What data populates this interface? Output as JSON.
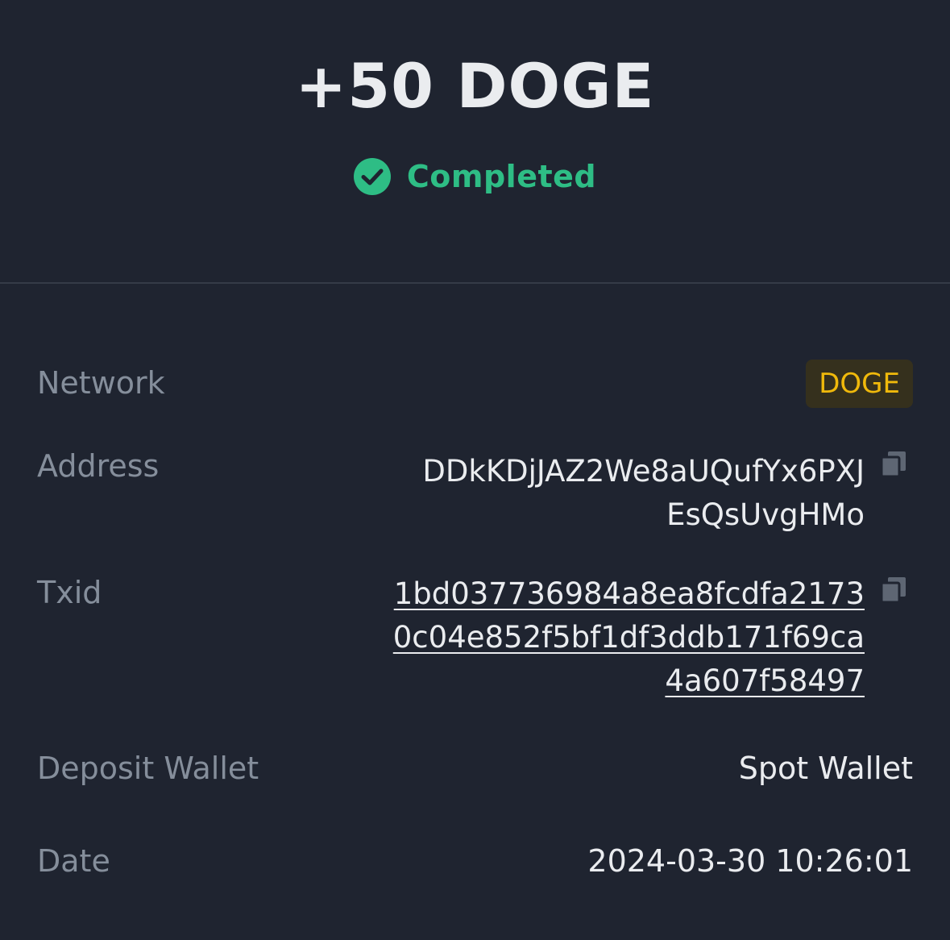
{
  "header": {
    "amount": "+50 DOGE",
    "status": "Completed"
  },
  "details": {
    "network_label": "Network",
    "network_value": "DOGE",
    "address_label": "Address",
    "address_line1": "DDkKDjJAZ2We8aUQufYx6PXJ",
    "address_line2": "EsQsUvgHMo",
    "txid_label": "Txid",
    "txid_line1": "1bd037736984a8ea8fcdfa2173",
    "txid_line2": "0c04e852f5bf1df3ddb171f69ca",
    "txid_line3": "4a607f58497",
    "wallet_label": "Deposit Wallet",
    "wallet_value": "Spot Wallet",
    "date_label": "Date",
    "date_value": "2024-03-30 10:26:01"
  },
  "icons": {
    "status": "check-circle-icon",
    "copy": "copy-icon"
  },
  "colors": {
    "background": "#1f2430",
    "success": "#2ebd85",
    "network_accent": "#f0b90b",
    "label": "#858e9b",
    "text": "#eaecef"
  }
}
